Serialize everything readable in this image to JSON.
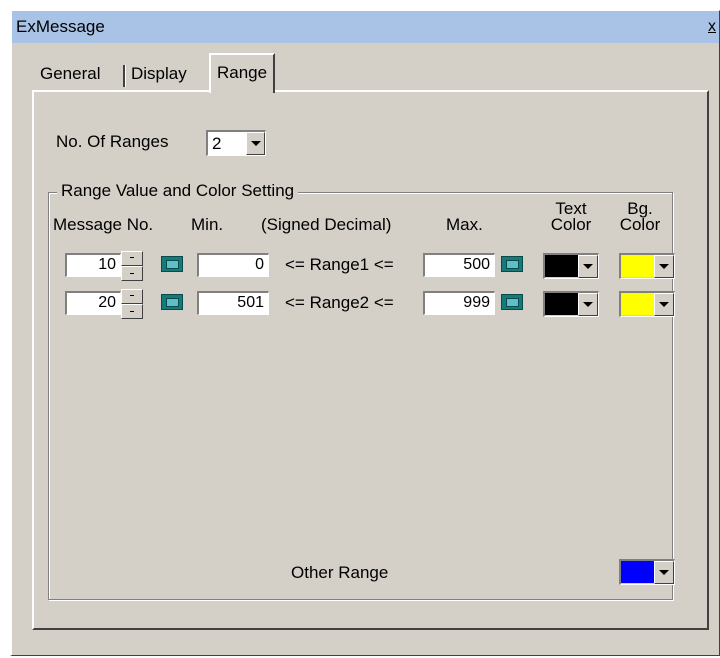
{
  "window": {
    "title": "ExMessage",
    "close_label": "x"
  },
  "tabs": [
    "General",
    "Display",
    "Range"
  ],
  "num_ranges": {
    "label": "No. Of Ranges",
    "value": "2"
  },
  "group": {
    "title": "Range Value and Color Setting",
    "headers": {
      "message_no": "Message No.",
      "min": "Min.",
      "signed": "(Signed Decimal)",
      "max": "Max.",
      "text_color": "Text Color",
      "bg_color": "Bg. Color"
    },
    "rows": [
      {
        "message_no": "10",
        "min": "0",
        "range_label": "<= Range1 <=",
        "max": "500",
        "text_color": "#000000",
        "bg_color": "#ffff00"
      },
      {
        "message_no": "20",
        "min": "501",
        "range_label": "<= Range2 <=",
        "max": "999",
        "text_color": "#000000",
        "bg_color": "#ffff00"
      }
    ],
    "other_range": {
      "label": "Other Range",
      "color": "#0000ff"
    }
  }
}
